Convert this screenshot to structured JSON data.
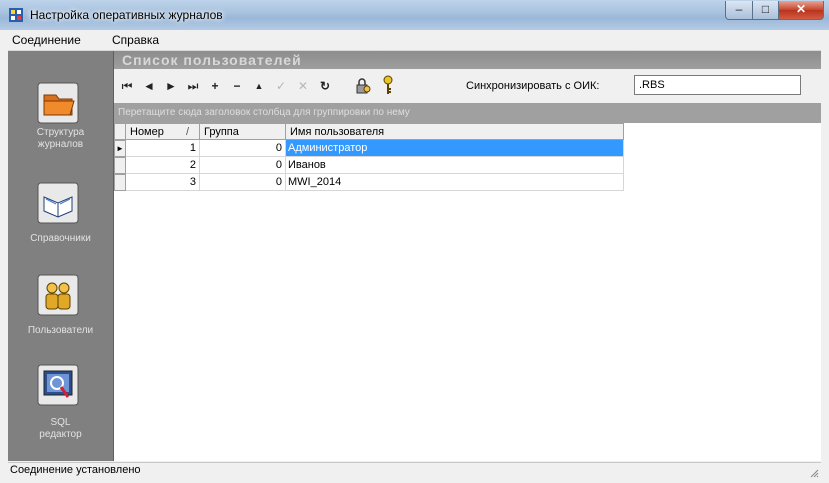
{
  "window": {
    "title": "Настройка оперативных журналов",
    "minimize": "–",
    "maximize": "□",
    "close": "✕"
  },
  "menu": {
    "items": [
      "Соединение",
      "Справка"
    ]
  },
  "nav": {
    "items": [
      {
        "label1": "Структура",
        "label2": "журналов",
        "icon": "folder-icon"
      },
      {
        "label1": "Справочники",
        "label2": "",
        "icon": "book-icon"
      },
      {
        "label1": "Пользователи",
        "label2": "",
        "icon": "users-icon"
      },
      {
        "label1": "SQL",
        "label2": "редактор",
        "icon": "sql-editor-icon"
      }
    ]
  },
  "panel": {
    "title": "Список пользователей"
  },
  "toolbar": {
    "first": "⏮",
    "prev": "◄",
    "next": "►",
    "last": "⏭",
    "add": "+",
    "remove": "−",
    "up": "▲",
    "edit": "✓",
    "cancel": "✕",
    "refresh": "↻",
    "sync_label": "Синхронизировать с ОИК:",
    "sync_value": ".RBS"
  },
  "grid": {
    "group_hint": "Перетащите сюда заголовок столбца для группировки по нему",
    "columns": {
      "number": "Номер",
      "sort_mark": "/",
      "group": "Группа",
      "name": "Имя пользователя"
    },
    "rows": [
      {
        "number": "1",
        "group": "0",
        "name": "Администратор",
        "selected": true,
        "indicator": "►"
      },
      {
        "number": "2",
        "group": "0",
        "name": "Иванов",
        "selected": false,
        "indicator": ""
      },
      {
        "number": "3",
        "group": "0",
        "name": "MWI_2014",
        "selected": false,
        "indicator": ""
      }
    ]
  },
  "status": {
    "text": "Соединение установлено"
  },
  "colors": {
    "nav_bg": "#808080",
    "selection": "#3399ff",
    "header_strip": "#9a9a9a"
  }
}
